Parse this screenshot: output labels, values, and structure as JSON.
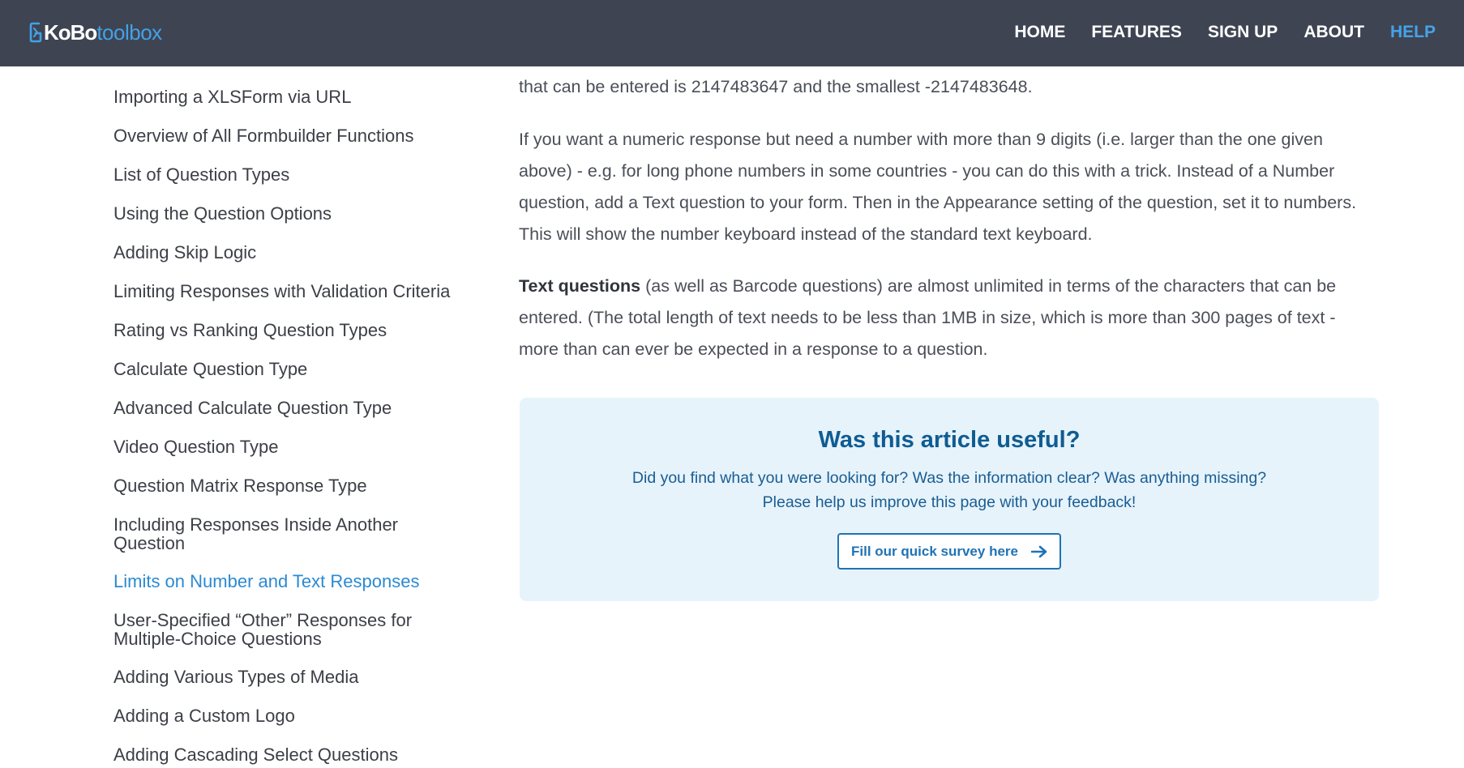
{
  "header": {
    "logo": {
      "kobo": "KoBo",
      "toolbox": "toolbox"
    },
    "nav": [
      "HOME",
      "FEATURES",
      "SIGN UP",
      "ABOUT",
      "HELP"
    ],
    "active_nav": "HELP"
  },
  "sidebar": {
    "items": [
      {
        "line1": "Importing a XLSForm via URL",
        "line2": ""
      },
      {
        "line1": "Overview of All Formbuilder Functions",
        "line2": ""
      },
      {
        "line1": "List of Question Types",
        "line2": ""
      },
      {
        "line1": "Using the Question Options",
        "line2": ""
      },
      {
        "line1": "Adding Skip Logic",
        "line2": ""
      },
      {
        "line1": "Limiting Responses with Validation Criteria",
        "line2": ""
      },
      {
        "line1": "Rating vs Ranking Question Types",
        "line2": ""
      },
      {
        "line1": "Calculate Question Type",
        "line2": ""
      },
      {
        "line1": "Advanced Calculate Question Type",
        "line2": ""
      },
      {
        "line1": "Video Question Type",
        "line2": ""
      },
      {
        "line1": "Question Matrix Response Type",
        "line2": ""
      },
      {
        "line1": "Including Responses Inside Another",
        "line2": "Question"
      },
      {
        "line1": "Limits on Number and Text Responses",
        "line2": ""
      },
      {
        "line1": "User-Specified “Other” Responses for",
        "line2": "Multiple-Choice Questions"
      },
      {
        "line1": "Adding Various Types of Media",
        "line2": ""
      },
      {
        "line1": "Adding a Custom Logo",
        "line2": ""
      },
      {
        "line1": "Adding Cascading Select Questions",
        "line2": ""
      }
    ],
    "active_item": "Limits on Number and Text Responses"
  },
  "article": {
    "p1": "that can be entered is 2147483647 and the smallest -2147483648.",
    "p2_lines": [
      "If you want a numeric response but need a number with more than 9 digits (i.e. larger than the one given",
      "above) - e.g. for long phone numbers in some countries - you can do this with a trick. Instead of a Number",
      "question, add a Text question to your form. Then in the Appearance setting of the question, set it to numbers.",
      "This will show the number keyboard instead of the standard text keyboard."
    ],
    "p3_bold": "Text questions",
    "p3_lines": [
      " (as well as Barcode questions) are almost unlimited in terms of the characters that can be",
      "entered. (The total length of text needs to be less than 1MB in size, which is more than 300 pages of text -",
      "more than can ever be expected in a response to a question."
    ]
  },
  "feedback": {
    "title": "Was this article useful?",
    "line1": "Did you find what you were looking for? Was the information clear? Was anything missing?",
    "line2": "Please help us improve this page with your feedback!",
    "button_label": "Fill our quick survey here",
    "button_icon": "arrow-right-icon"
  },
  "colors": {
    "header_bg": "#3e4452",
    "accent": "#45a3e8",
    "active_link": "#2c8ad1",
    "feedback_bg": "#e6f3fb",
    "feedback_title": "#0f5c92"
  }
}
